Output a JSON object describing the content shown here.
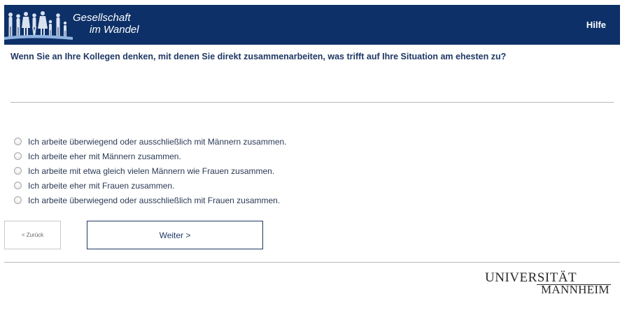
{
  "header": {
    "logo_line1": "Gesellschaft",
    "logo_line2": "im Wandel",
    "help_label": "Hilfe",
    "logo_icon": "people-silhouettes-icon",
    "background_color": "#0d3068"
  },
  "question": {
    "text": "Wenn Sie an Ihre Kollegen denken, mit denen Sie direkt zusammenarbeiten, was trifft auf Ihre Situation am ehesten zu?"
  },
  "options": [
    {
      "label": "Ich arbeite überwiegend oder ausschließlich mit Männern zusammen.",
      "selected": false
    },
    {
      "label": "Ich arbeite eher mit Männern zusammen.",
      "selected": false
    },
    {
      "label": "Ich arbeite mit etwa gleich vielen Männern wie Frauen zusammen.",
      "selected": false
    },
    {
      "label": "Ich arbeite eher mit Frauen zusammen.",
      "selected": false
    },
    {
      "label": "Ich arbeite überwiegend oder ausschließlich mit Frauen zusammen.",
      "selected": false
    }
  ],
  "navigation": {
    "back_label": "< Zurück",
    "next_label": "Weiter >"
  },
  "footer": {
    "university_line1": "UNIVERSITÄT",
    "university_line2": "MANNHEIM"
  }
}
